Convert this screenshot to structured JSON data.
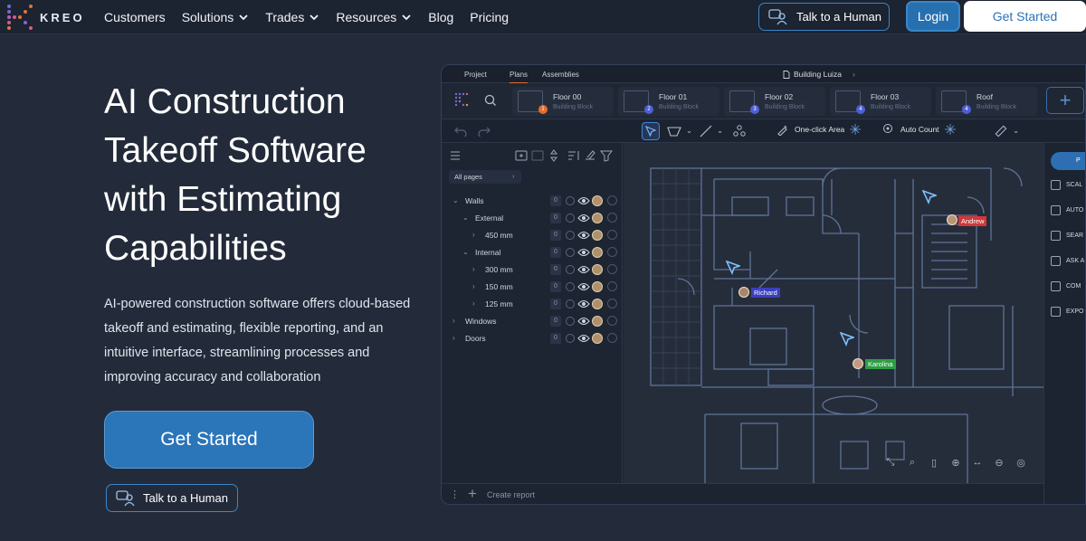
{
  "brand": {
    "name": "KREO"
  },
  "nav": {
    "items": [
      {
        "label": "Customers",
        "dropdown": false
      },
      {
        "label": "Solutions",
        "dropdown": true
      },
      {
        "label": "Trades",
        "dropdown": true
      },
      {
        "label": "Resources",
        "dropdown": true
      },
      {
        "label": "Blog",
        "dropdown": false
      },
      {
        "label": "Pricing",
        "dropdown": false
      }
    ],
    "talk_label": "Talk to a Human",
    "login_label": "Login",
    "get_started_label": "Get Started"
  },
  "hero": {
    "title_lines": [
      "AI Construction",
      "Takeoff Software",
      "with Estimating",
      "Capabilities"
    ],
    "description": "AI-powered construction software offers cloud-based takeoff and estimating, flexible reporting, and an intuitive interface, streamlining processes and improving accuracy and collaboration",
    "cta_label": "Get Started",
    "talk_label": "Talk to a Human"
  },
  "app": {
    "tabs": [
      "Project",
      "Plans",
      "Assemblies"
    ],
    "active_tab": "Plans",
    "project_name": "Building Luiza",
    "floors": [
      {
        "name": "Floor 00",
        "sub": "Building Block",
        "badge": "1",
        "badge_color": "#e36d2f"
      },
      {
        "name": "Floor 01",
        "sub": "Building Block",
        "badge": "2",
        "badge_color": "#4e5fd6"
      },
      {
        "name": "Floor 02",
        "sub": "Building Block",
        "badge": "3",
        "badge_color": "#4e5fd6"
      },
      {
        "name": "Floor 03",
        "sub": "Building Block",
        "badge": "4",
        "badge_color": "#4e5fd6"
      },
      {
        "name": "Roof",
        "sub": "Building Block",
        "badge": "4",
        "badge_color": "#4e5fd6"
      }
    ],
    "toolbar": {
      "one_click_area": "One-click Area",
      "auto_count": "Auto Count"
    },
    "filter": {
      "all_pages": "All pages"
    },
    "tree": [
      {
        "label": "Walls",
        "level": 0,
        "expanded": true,
        "count": "0"
      },
      {
        "label": "External",
        "level": 1,
        "expanded": true,
        "count": "0"
      },
      {
        "label": "450 mm",
        "level": 2,
        "expanded": false,
        "count": "0"
      },
      {
        "label": "Internal",
        "level": 1,
        "expanded": true,
        "count": "0"
      },
      {
        "label": "300 mm",
        "level": 2,
        "expanded": false,
        "count": "0"
      },
      {
        "label": "150 mm",
        "level": 2,
        "expanded": false,
        "count": "0"
      },
      {
        "label": "125 mm",
        "level": 2,
        "expanded": false,
        "count": "0"
      },
      {
        "label": "Windows",
        "level": 0,
        "expanded": false,
        "count": "0"
      },
      {
        "label": "Doors",
        "level": 0,
        "expanded": false,
        "count": "0"
      }
    ],
    "collaborators": [
      {
        "name": "Andrew",
        "color": "#d2383a"
      },
      {
        "name": "Richard",
        "color": "#3b3fbf"
      },
      {
        "name": "Karolina",
        "color": "#2e9e45"
      }
    ],
    "right_panel": {
      "top_label": "P",
      "items": [
        "SCAL",
        "AUTO",
        "SEAR",
        "ASK A",
        "COM",
        "EXPO"
      ]
    },
    "bottom": {
      "create_report": "Create report"
    }
  }
}
